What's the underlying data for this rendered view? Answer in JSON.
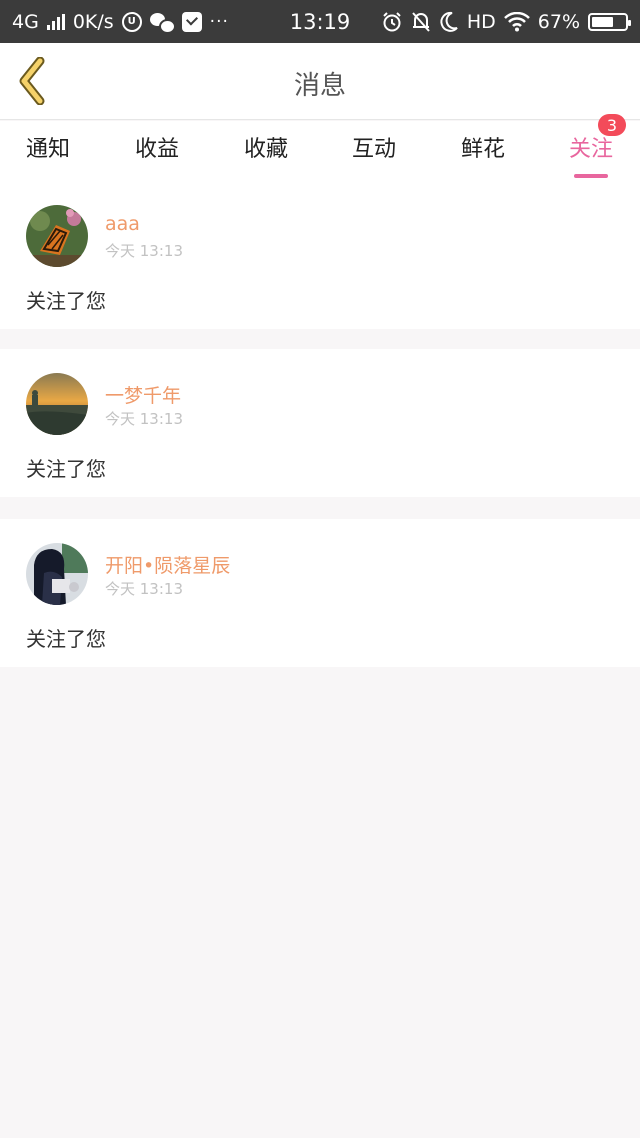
{
  "status_bar": {
    "network": "4G",
    "speed": "0K/s",
    "time": "13:19",
    "hd": "HD",
    "battery": "67%",
    "battery_level": 0.67,
    "more": "···"
  },
  "header": {
    "title": "消息",
    "back_icon": "chevron-left-icon"
  },
  "tabs": [
    {
      "label": "通知",
      "active": false
    },
    {
      "label": "收益",
      "active": false
    },
    {
      "label": "收藏",
      "active": false
    },
    {
      "label": "互动",
      "active": false
    },
    {
      "label": "鲜花",
      "active": false
    },
    {
      "label": "关注",
      "active": true,
      "badge": "3"
    }
  ],
  "colors": {
    "accent": "#e8669e",
    "name": "#ef9a6a",
    "badge": "#f34b5a",
    "status_bar": "#3b3b3b"
  },
  "messages": [
    {
      "name": "aaa",
      "time": "今天 13:13",
      "text": "关注了您",
      "avatar_icon": "butterfly-avatar"
    },
    {
      "name": "一梦千年",
      "time": "今天 13:13",
      "text": "关注了您",
      "avatar_icon": "sunset-avatar"
    },
    {
      "name": "开阳•陨落星辰",
      "time": "今天 13:13",
      "text": "关注了您",
      "avatar_icon": "girl-avatar"
    }
  ]
}
